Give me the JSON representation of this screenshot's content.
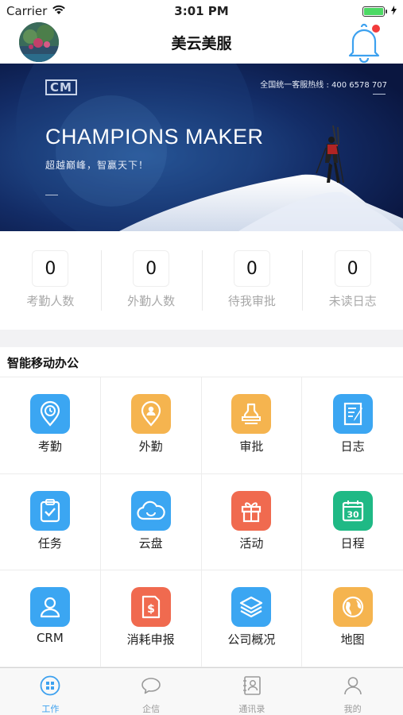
{
  "status_bar": {
    "carrier": "Carrier",
    "time": "3:01 PM"
  },
  "header": {
    "title": "美云美服"
  },
  "banner": {
    "logo": "CM",
    "hotline": "全国统一客服热线 : 400 6578 707",
    "heading": "CHAMPIONS MAKER",
    "slogan": "超越巅峰，智赢天下！"
  },
  "stats": [
    {
      "value": "0",
      "label": "考勤人数"
    },
    {
      "value": "0",
      "label": "外勤人数"
    },
    {
      "value": "0",
      "label": "待我审批"
    },
    {
      "value": "0",
      "label": "未读日志"
    }
  ],
  "section": {
    "title": "智能移动办公"
  },
  "apps": [
    {
      "label": "考勤",
      "icon": "clock-pin-icon",
      "color": "#3ba6f2"
    },
    {
      "label": "外勤",
      "icon": "person-pin-icon",
      "color": "#f5b44f"
    },
    {
      "label": "审批",
      "icon": "stamp-icon",
      "color": "#f5b44f"
    },
    {
      "label": "日志",
      "icon": "notebook-pen-icon",
      "color": "#3ba6f2"
    },
    {
      "label": "任务",
      "icon": "clipboard-check-icon",
      "color": "#3ba6f2"
    },
    {
      "label": "云盘",
      "icon": "cloud-icon",
      "color": "#3ba6f2"
    },
    {
      "label": "活动",
      "icon": "gift-icon",
      "color": "#f06a4f"
    },
    {
      "label": "日程",
      "icon": "calendar-icon",
      "color": "#1fb985"
    },
    {
      "label": "CRM",
      "icon": "user-icon",
      "color": "#3ba6f2"
    },
    {
      "label": "消耗申报",
      "icon": "dollar-doc-icon",
      "color": "#f06a4f"
    },
    {
      "label": "公司概况",
      "icon": "layers-icon",
      "color": "#3ba6f2"
    },
    {
      "label": "地图",
      "icon": "globe-icon",
      "color": "#f5b44f"
    }
  ],
  "tabs": [
    {
      "label": "工作",
      "icon": "grid-icon",
      "active": true
    },
    {
      "label": "企信",
      "icon": "chat-icon",
      "active": false
    },
    {
      "label": "通讯录",
      "icon": "contacts-icon",
      "active": false
    },
    {
      "label": "我的",
      "icon": "profile-icon",
      "active": false
    }
  ],
  "colors": {
    "accent": "#3da1ef",
    "badge": "#f23b3b",
    "banner_bg": "#0d1f4f"
  }
}
